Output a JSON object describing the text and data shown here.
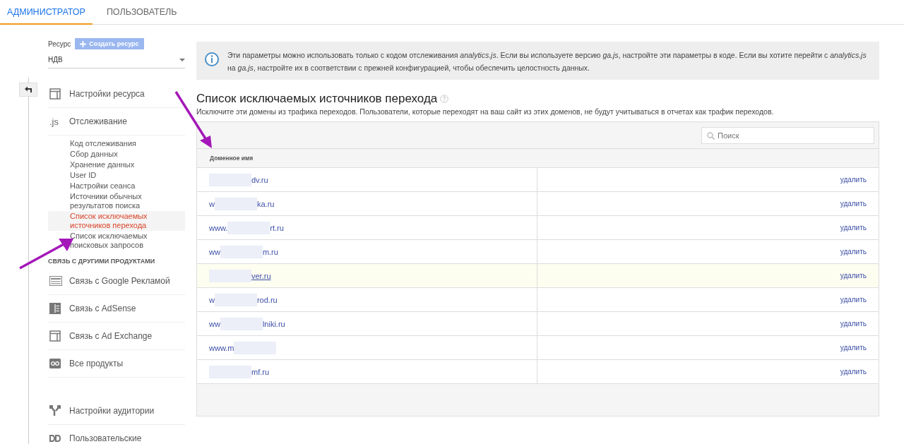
{
  "tabs": [
    {
      "label": "АДМИНИСТРАТОР",
      "selected": true
    },
    {
      "label": "ПОЛЬЗОВАТЕЛЬ",
      "selected": false
    }
  ],
  "resource": {
    "label": "Ресурс",
    "create_button": "Создать ресурс",
    "value": "НДВ"
  },
  "nav": [
    {
      "items": [
        {
          "label": "Настройки ресурса"
        },
        {
          "icon_text": ".js",
          "label": "Отслеживание",
          "children": [
            {
              "label": "Код отслеживания",
              "selected": false
            },
            {
              "label": "Сбор данных",
              "selected": false
            },
            {
              "label": "Хранение данных",
              "selected": false
            },
            {
              "label": "User ID",
              "selected": false
            },
            {
              "label": "Настройки сеанса",
              "selected": false
            },
            {
              "label": "Источники обычных результатов поиска",
              "selected": false
            },
            {
              "label": "Список исключаемых источников перехода",
              "selected": true
            },
            {
              "label": "Список исключаемых поисковых запросов",
              "selected": false
            }
          ]
        }
      ]
    },
    {
      "heading": "СВЯЗЬ С ДРУГИМИ ПРОДУКТАМИ",
      "items": [
        {
          "label": "Связь с Google Рекламой"
        },
        {
          "label": "Связь с AdSense"
        },
        {
          "label": "Связь с Ad Exchange"
        },
        {
          "label": "Все продукты"
        }
      ]
    },
    {
      "items": [
        {
          "label": "Настройки аудитории"
        },
        {
          "label": "Пользовательские"
        }
      ]
    }
  ],
  "info": "Эти параметры можно использовать только с кодом отслеживания *analytics.js*. Если вы используете версию *ga.js*, настройте эти параметры в коде. Если вы хотите перейти с *analytics.js* на *ga.js*, настройте их в соответствии с прежней конфигурацией, чтобы обеспечить целостность данных.",
  "title": "Список исключаемых источников перехода",
  "description": "Исключите эти домены из трафика переходов. Пользователи, которые переходят на ваш сайт из этих доменов, не будут учитываться в отчетах как трафик переходов.",
  "search": {
    "placeholder": "Поиск"
  },
  "table": {
    "columns": [
      "Доменное имя"
    ],
    "rows": [
      {
        "prefix": "",
        "suffix": "dv.ru",
        "highlighted": false,
        "action": "удалить"
      },
      {
        "prefix": "w",
        "suffix": "ka.ru",
        "highlighted": false,
        "action": "удалить"
      },
      {
        "prefix": "www.",
        "suffix": "rt.ru",
        "highlighted": false,
        "action": "удалить"
      },
      {
        "prefix": "ww",
        "suffix": "m.ru",
        "highlighted": false,
        "action": "удалить"
      },
      {
        "prefix": "",
        "suffix": "ver.ru",
        "highlighted": true,
        "action": "удалить"
      },
      {
        "prefix": "w",
        "suffix": "rod.ru",
        "highlighted": false,
        "action": "удалить"
      },
      {
        "prefix": "ww",
        "suffix": "lniki.ru",
        "highlighted": false,
        "action": "удалить"
      },
      {
        "prefix": "www.m",
        "suffix": "",
        "highlighted": false,
        "action": "удалить"
      },
      {
        "prefix": "",
        "suffix": "mf.ru",
        "highlighted": false,
        "action": "удалить"
      }
    ]
  }
}
